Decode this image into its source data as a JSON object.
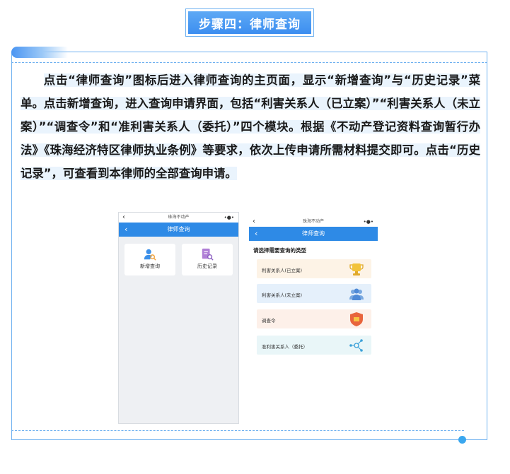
{
  "step_title": "步骤四：律师查询",
  "paragraph": {
    "line1": "点击“律师查询”图标后进入律师查询的主页面，显示“新增查询”与“历",
    "line2": "史记录”菜单。点击新增查询，进入查询申请界面，包括“利害关系人（已",
    "line3": "立案）”“利害关系人（未立案）”“调查令”和“准利害关系人（委托）”四个",
    "line4": "模块。根据《不动产登记资料查询暂行办法》《珠海经济特区律师执业条",
    "line5": "例》等要求，依次上传申请所需材料提交即可。点击“历史记录”，可查看",
    "line6": "到本律师的全部查询申请。"
  },
  "phone1": {
    "status_title": "珠海不动产",
    "nav_title": "律师查询",
    "tiles": [
      {
        "label": "新增查询",
        "icon": "person-search-icon"
      },
      {
        "label": "历史记录",
        "icon": "record-search-icon"
      }
    ]
  },
  "phone2": {
    "status_title": "珠海不动产",
    "nav_title": "律师查询",
    "section_title": "请选择需要查询的类型",
    "cards": [
      {
        "label": "利害关系人(已立案)",
        "icon": "trophy-icon"
      },
      {
        "label": "利害关系人(未立案)",
        "icon": "group-icon"
      },
      {
        "label": "调查令",
        "icon": "shield-icon"
      },
      {
        "label": "准利害关系人（委托）",
        "icon": "network-icon"
      }
    ]
  },
  "colors": {
    "accent": "#3c8ef0",
    "frame": "#6fb1f0",
    "dot": "#3aa7ef"
  }
}
